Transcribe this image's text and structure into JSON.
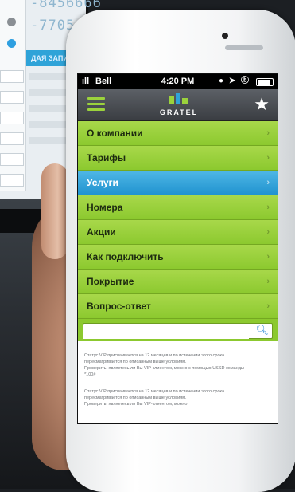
{
  "background": {
    "phone_number_1": "-8456666",
    "phone_number_2": "-7705",
    "form_header": "ДАЯ ЗАПИСИ"
  },
  "status_bar": {
    "carrier": "Bell",
    "time": "4:20 PM",
    "icons": "● ➤ ⓑ"
  },
  "app": {
    "logo_text": "GRATEL",
    "brand_green": "#8cc92f",
    "active_blue": "#2193cf"
  },
  "menu": {
    "items": [
      {
        "label": "О компании",
        "active": false
      },
      {
        "label": "Тарифы",
        "active": false
      },
      {
        "label": "Услуги",
        "active": true
      },
      {
        "label": "Номера",
        "active": false
      },
      {
        "label": "Акции",
        "active": false
      },
      {
        "label": "Как подключить",
        "active": false
      },
      {
        "label": "Покрытие",
        "active": false
      },
      {
        "label": "Вопрос-ответ",
        "active": false
      }
    ]
  },
  "search": {
    "value": "",
    "placeholder": ""
  },
  "info": {
    "block1_line1": "Статус VIP присваивается на 12 месяцев и по истечении этого срока",
    "block1_line2": "пересматривается по описанным выше условиям.",
    "block1_line3": "Проверить, являетесь ли Вы VIP-клиентом, можно с помощью USSD-команды",
    "block1_line4": "*100#",
    "block2_line1": "Статус VIP присваивается на 12 месяцев и по истечении этого срока",
    "block2_line2": "пересматривается по описанным выше условиям.",
    "block2_line3": "Проверить, являетесь ли Вы VIP-клиентом, можно"
  }
}
